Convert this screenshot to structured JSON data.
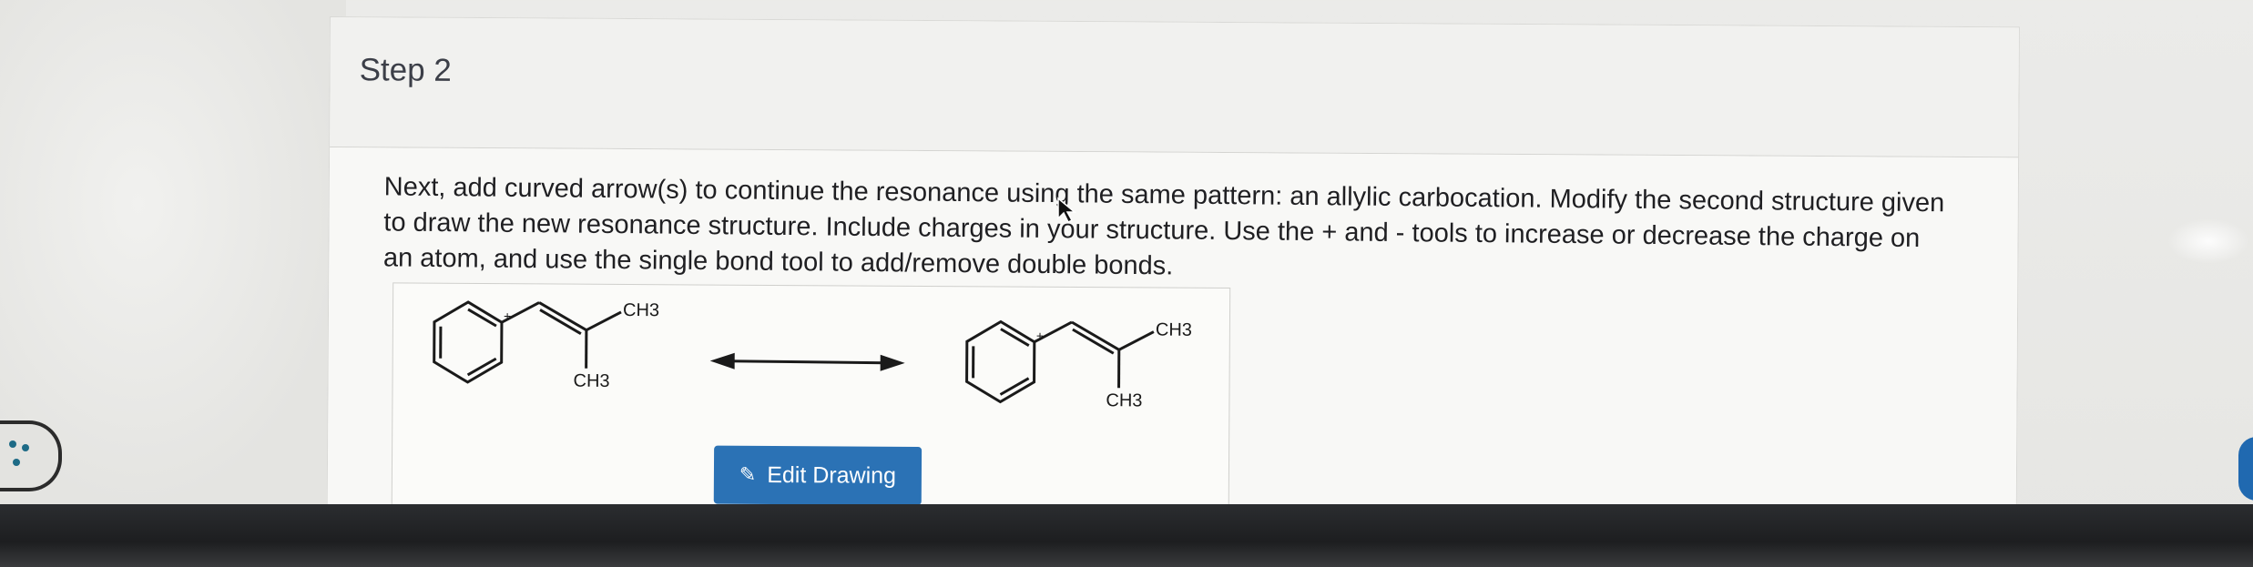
{
  "step": {
    "title": "Step 2",
    "instructions": "Next, add curved arrow(s) to continue the resonance using the same pattern: an allylic carbocation. Modify the second structure given to draw the new resonance structure. Include charges in your structure. Use the + and - tools to increase or decrease the charge on an atom, and use the single bond tool to add/remove double bonds."
  },
  "drawing": {
    "structure_1": {
      "methyl_top": "CH3",
      "methyl_bottom": "CH3",
      "charge": "+"
    },
    "structure_2": {
      "methyl_top": "CH3",
      "methyl_bottom": "CH3",
      "charge": "+"
    },
    "arrow": "resonance-double-arrow",
    "edit_button_label": "Edit Drawing",
    "edit_button_icon": "pencil-icon"
  },
  "widgets": {
    "cookie_icon": "cookie-icon"
  },
  "colors": {
    "button": "#2b72b5",
    "text": "#1f1f22",
    "title": "#3c3f48"
  }
}
